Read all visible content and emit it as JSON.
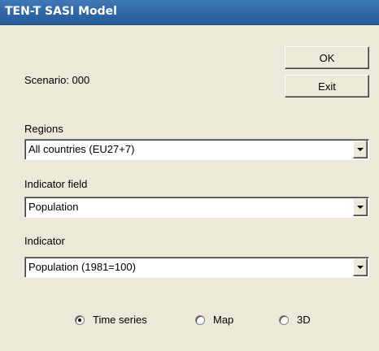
{
  "window": {
    "title": "TEN-T SASI Model"
  },
  "scenario": {
    "label": "Scenario: 000"
  },
  "buttons": {
    "ok": "OK",
    "exit": "Exit"
  },
  "regions": {
    "label": "Regions",
    "value": "All countries (EU27+7)"
  },
  "indicator_field": {
    "label": "Indicator field",
    "value": "Population"
  },
  "indicator": {
    "label": "Indicator",
    "value": "Population (1981=100)"
  },
  "view_mode": {
    "options": [
      {
        "label": "Time series",
        "selected": true
      },
      {
        "label": "Map",
        "selected": false
      },
      {
        "label": "3D",
        "selected": false
      }
    ]
  }
}
